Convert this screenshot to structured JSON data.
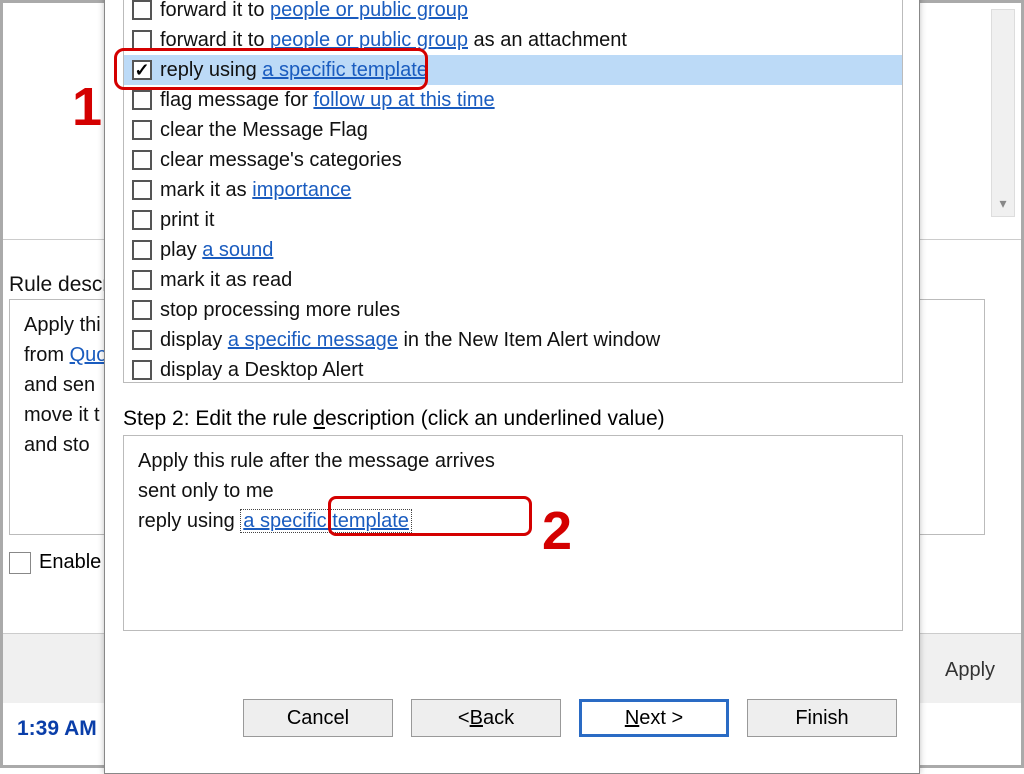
{
  "bg": {
    "rule_desc_label": "Rule descr",
    "desc_lines": {
      "l1": "Apply thi",
      "l2_pre": "from ",
      "l2_link": "Quo",
      "l3": "  and sen",
      "l4": "move it t",
      "l5": "  and sto"
    },
    "enable_label": "Enable",
    "apply_label": "Apply",
    "time": "1:39 AM"
  },
  "actions": [
    {
      "checked": false,
      "pre": "forward it to ",
      "link": "people or public group",
      "post": ""
    },
    {
      "checked": false,
      "pre": "forward it to ",
      "link": "people or public group",
      "post": " as an attachment"
    },
    {
      "checked": true,
      "pre": "reply using ",
      "link": "a specific template",
      "post": "",
      "selected": true
    },
    {
      "checked": false,
      "pre": "flag message for ",
      "link": "follow up at this time",
      "post": ""
    },
    {
      "checked": false,
      "pre": "clear the Message Flag",
      "link": "",
      "post": ""
    },
    {
      "checked": false,
      "pre": "clear message's categories",
      "link": "",
      "post": ""
    },
    {
      "checked": false,
      "pre": "mark it as ",
      "link": "importance",
      "post": ""
    },
    {
      "checked": false,
      "pre": "print it",
      "link": "",
      "post": ""
    },
    {
      "checked": false,
      "pre": "play ",
      "link": "a sound",
      "post": ""
    },
    {
      "checked": false,
      "pre": "mark it as read",
      "link": "",
      "post": ""
    },
    {
      "checked": false,
      "pre": "stop processing more rules",
      "link": "",
      "post": ""
    },
    {
      "checked": false,
      "pre": "display ",
      "link": "a specific message",
      "post": " in the New Item Alert window"
    },
    {
      "checked": false,
      "pre": "display a Desktop Alert",
      "link": "",
      "post": ""
    }
  ],
  "step2": {
    "label_pre": "Step 2: Edit the rule ",
    "label_acc": "d",
    "label_post": "escription (click an underlined value)",
    "line1": "Apply this rule after the message arrives",
    "line2": "sent only to me",
    "line3_pre": "reply using ",
    "line3_link": "a specific template"
  },
  "buttons": {
    "cancel": "Cancel",
    "back_pre": "< ",
    "back_acc": "B",
    "back_post": "ack",
    "next_acc": "N",
    "next_post": "ext >",
    "finish": "Finish"
  },
  "annotations": {
    "one": "1",
    "two": "2"
  }
}
